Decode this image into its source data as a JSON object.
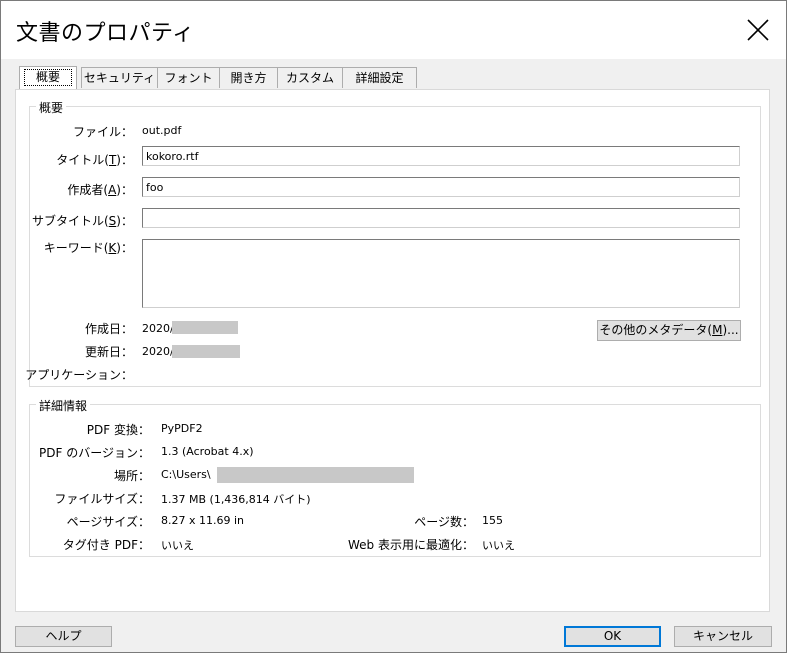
{
  "window": {
    "title": "文書のプロパティ"
  },
  "tabs": [
    {
      "label": "概要"
    },
    {
      "label": "セキュリティ"
    },
    {
      "label": "フォント"
    },
    {
      "label": "開き方"
    },
    {
      "label": "カスタム"
    },
    {
      "label": "詳細設定"
    }
  ],
  "summary": {
    "legend": "概要",
    "file_label": "ファイル：",
    "file_value": "out.pdf",
    "title_label": "タイトル",
    "title_key": "T",
    "title_value": "kokoro.rtf",
    "author_label": "作成者",
    "author_key": "A",
    "author_value": "foo",
    "subject_label": "サブタイトル",
    "subject_key": "S",
    "subject_value": "",
    "keywords_label": "キーワード",
    "keywords_key": "K",
    "keywords_value": "",
    "colon": "：",
    "created_label": "作成日：",
    "created_value": "2020/0",
    "modified_label": "更新日：",
    "modified_value": "2020/0",
    "app_label": "アプリケーション：",
    "app_value": "",
    "more_meta_label": "その他のメタデータ",
    "more_meta_key": "M",
    "more_meta_suffix": "..."
  },
  "details": {
    "legend": "詳細情報",
    "producer_label": "PDF 変換：",
    "producer_value": "PyPDF2",
    "version_label": "PDF のバージョン：",
    "version_value": "1.3 (Acrobat 4.x)",
    "location_label": "場所：",
    "location_value": "C:\\Users\\",
    "filesize_label": "ファイルサイズ：",
    "filesize_value": "1.37 MB (1,436,814 バイト)",
    "pagesize_label": "ページサイズ：",
    "pagesize_value": "8.27 x 11.69 in",
    "pages_label": "ページ数：",
    "pages_value": "155",
    "tagged_label": "タグ付き PDF：",
    "tagged_value": "いいえ",
    "fastweb_label": "Web 表示用に最適化：",
    "fastweb_value": "いいえ"
  },
  "footer": {
    "help_label": "ヘルプ",
    "ok_label": "OK",
    "cancel_label": "キャンセル"
  }
}
